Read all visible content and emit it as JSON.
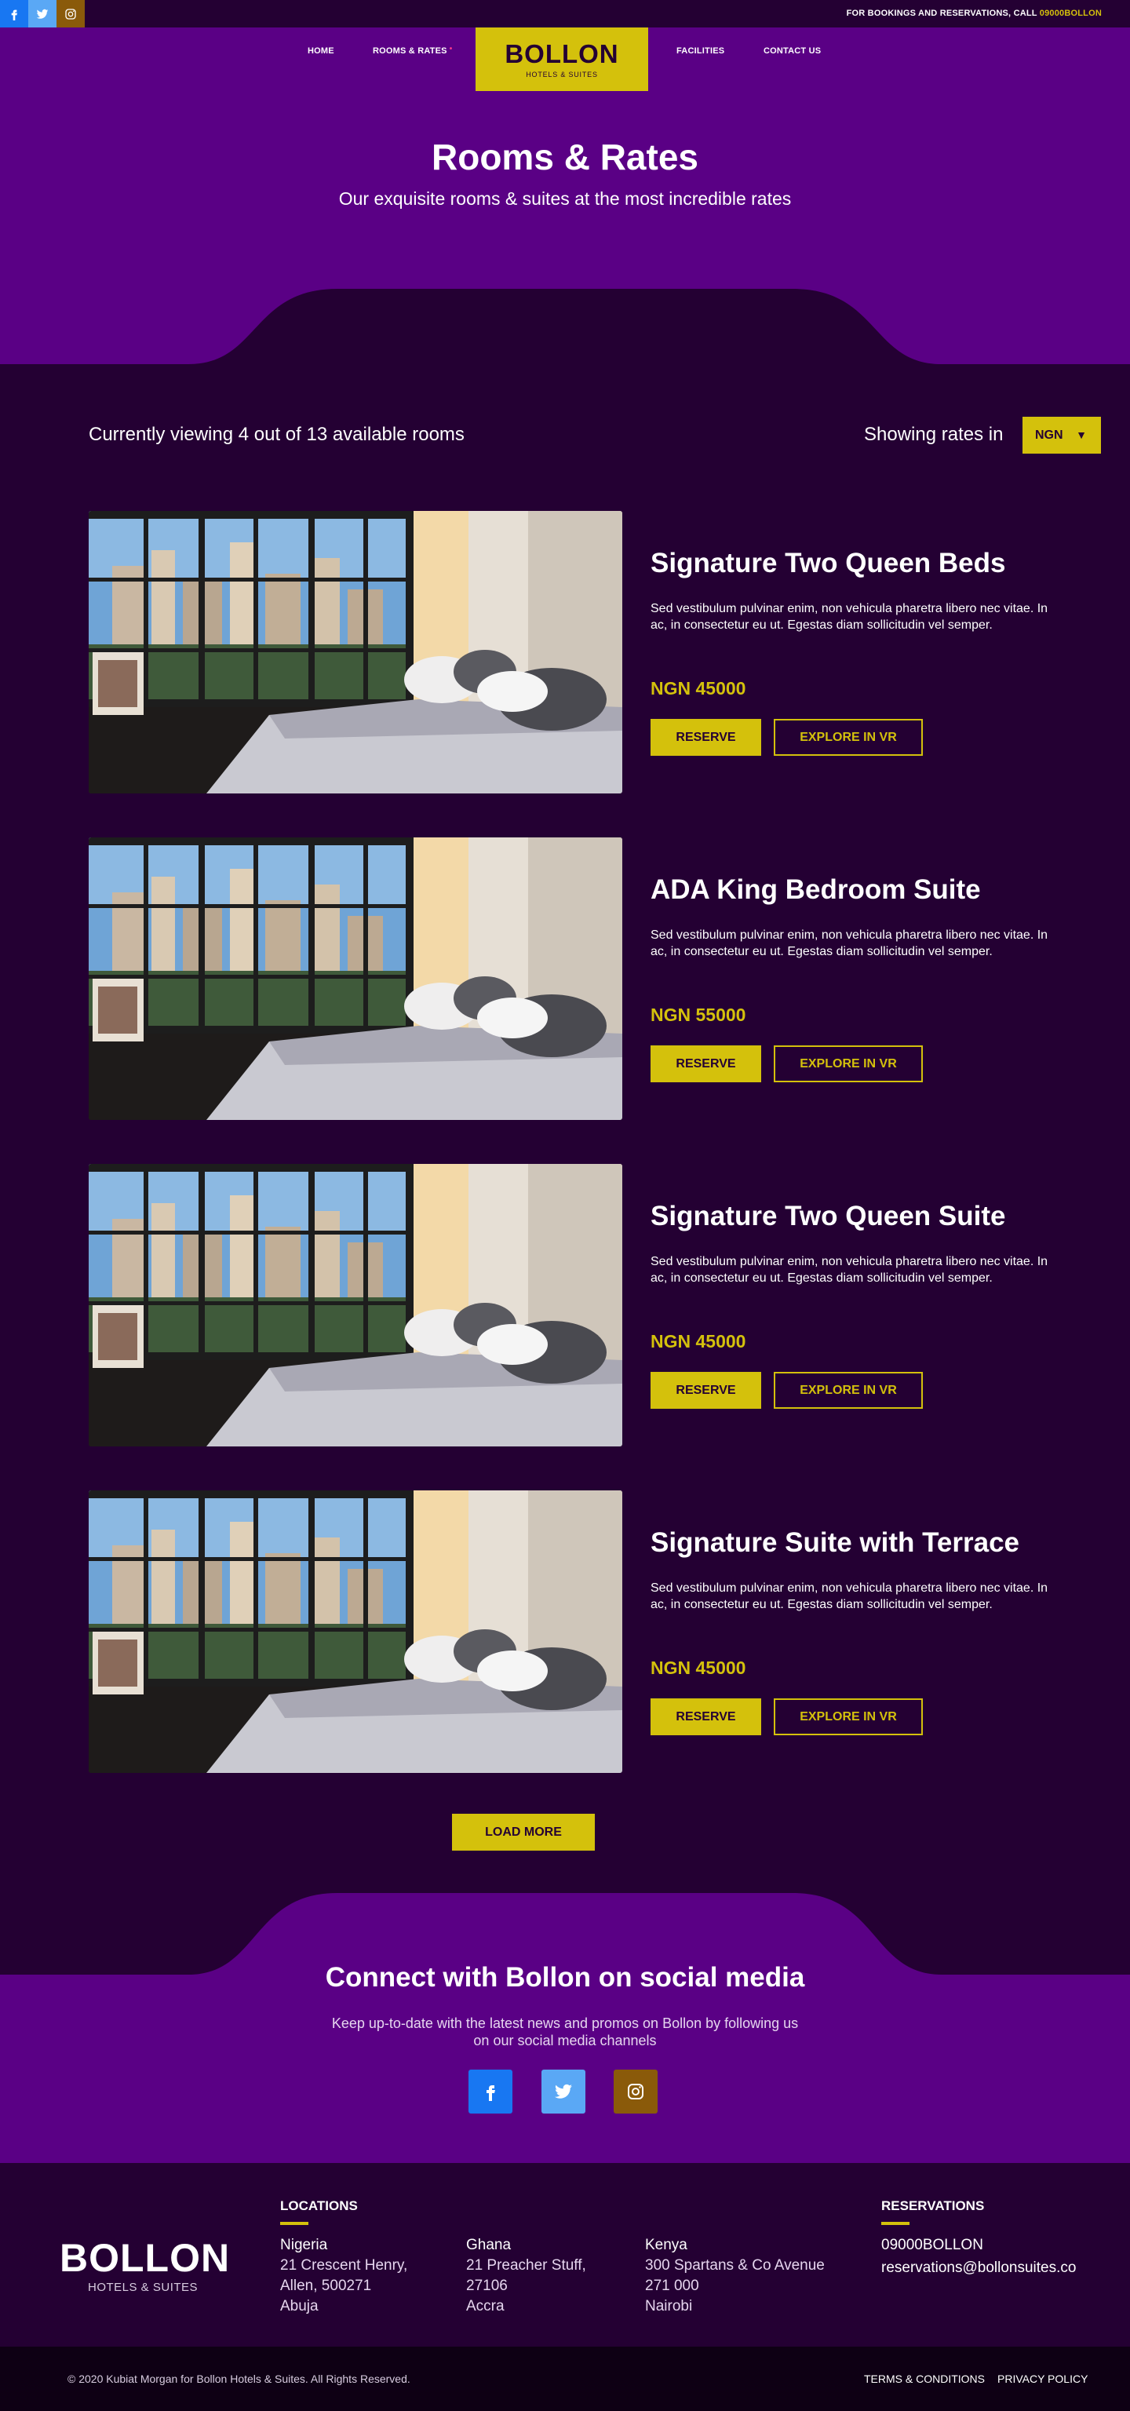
{
  "topbar": {
    "social": [
      "facebook-icon",
      "twitter-icon",
      "instagram-icon"
    ],
    "booking_text": "FOR BOOKINGS AND RESERVATIONS, CALL ",
    "booking_phone": "09000BOLLON"
  },
  "nav": {
    "items": [
      "HOME",
      "ROOMS & RATES",
      "FACILITIES",
      "CONTACT US"
    ],
    "active_marker": "•",
    "logo_title": "BOLLON",
    "logo_sub": "HOTELS & SUITES"
  },
  "hero": {
    "title": "Rooms & Rates",
    "subtitle": "Our exquisite rooms & suites at the most incredible rates"
  },
  "listing": {
    "count_text": "Currently viewing 4 out of 13 available rooms",
    "rates_label": "Showing rates in",
    "currency": "NGN",
    "caret": "▼"
  },
  "rooms": [
    {
      "title": "Signature Two Queen Beds",
      "desc": "Sed vestibulum pulvinar enim, non vehicula pharetra libero nec vitae. In ac, in consectetur eu ut. Egestas diam sollicitudin vel semper.",
      "price": "NGN 45000",
      "reserve": "RESERVE",
      "vr": "EXPLORE IN VR"
    },
    {
      "title": "ADA King Bedroom Suite",
      "desc": "Sed vestibulum pulvinar enim, non vehicula pharetra libero nec vitae. In ac, in consectetur eu ut. Egestas diam sollicitudin vel semper.",
      "price": "NGN 55000",
      "reserve": "RESERVE",
      "vr": "EXPLORE IN VR"
    },
    {
      "title": "Signature Two Queen Suite",
      "desc": "Sed vestibulum pulvinar enim, non vehicula pharetra libero nec vitae. In ac, in consectetur eu ut. Egestas diam sollicitudin vel semper.",
      "price": "NGN 45000",
      "reserve": "RESERVE",
      "vr": "EXPLORE IN VR"
    },
    {
      "title": "Signature Suite with Terrace",
      "desc": "Sed vestibulum pulvinar enim, non vehicula pharetra libero nec vitae. In ac, in consectetur eu ut. Egestas diam sollicitudin vel semper.",
      "price": "NGN 45000",
      "reserve": "RESERVE",
      "vr": "EXPLORE IN VR"
    }
  ],
  "load_more": "LOAD MORE",
  "social": {
    "title": "Connect with Bollon on social media",
    "subtitle": "Keep up-to-date with the latest news and promos on Bollon by following us on our social media channels"
  },
  "footer": {
    "logo_title": "BOLLON",
    "logo_sub": "HOTELS & SUITES",
    "locations_heading": "LOCATIONS",
    "locations": [
      {
        "city": "Nigeria",
        "lines": [
          "21 Crescent Henry,",
          "Allen, 500271",
          "Abuja"
        ]
      },
      {
        "city": "Ghana",
        "lines": [
          "21 Preacher Stuff,",
          "27106",
          "Accra"
        ]
      },
      {
        "city": "Kenya",
        "lines": [
          "300 Spartans & Co Avenue",
          "271 000",
          "Nairobi"
        ]
      }
    ],
    "reservations_heading": "RESERVATIONS",
    "phone": "09000BOLLON",
    "email": "reservations@bollonsuites.co",
    "copyright": "© 2020 Kubiat Morgan for Bollon Hotels & Suites. All Rights Reserved.",
    "links": [
      "TERMS & CONDITIONS",
      "PRIVACY POLICY"
    ]
  },
  "colors": {
    "accent": "#d4c10c",
    "purple": "#5a0085",
    "dark": "#240033",
    "facebook": "#1877f2",
    "twitter": "#5aa8f5",
    "instagram": "#8a5a0a"
  }
}
